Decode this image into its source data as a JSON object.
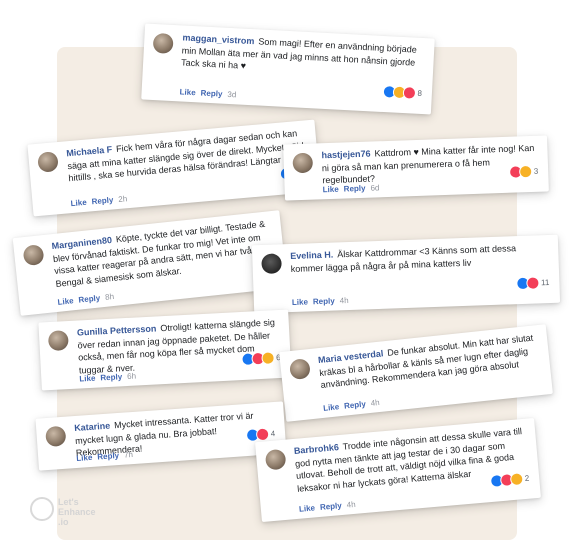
{
  "watermark": {
    "line1": "Let's",
    "line2": "Enhance",
    ".io_text": ".io"
  },
  "cards": [
    {
      "author": "maggan_vistrom",
      "text": "Som magi! Efter en användning började min Mollan äta mer än vad jag minns att hon nånsin gjorde Tack ska ni ha ♥",
      "like": "Like",
      "reply": "Reply",
      "time": "3d",
      "count": "8"
    },
    {
      "author": "Michaela F",
      "text": "Fick hem våra för några dagar sedan och kan säga att mina katter slängde sig över de direkt. Mycket nöjd hittills , ska se hurvida deras hälsa förändras! Längtar",
      "like": "Like",
      "reply": "Reply",
      "time": "2h",
      "count": "2"
    },
    {
      "author": "hastjejen76",
      "text": "Kattdrom ♥ Mina katter får inte nog! Kan ni göra så man kan prenumerera o få hem regelbundet?",
      "like": "Like",
      "reply": "Reply",
      "time": "6d",
      "count": "3"
    },
    {
      "author": "Marganinen80",
      "text": "Köpte, tyckte det var billigt. Testade & blev förvånad faktiskt. De funkar tro mig! Vet inte om vissa katter reagerar på andra sätt, men vi har två Bengal & siamesisk som älskar.",
      "like": "Like",
      "reply": "Reply",
      "time": "8h",
      "count": ""
    },
    {
      "author": "Evelina H.",
      "text": "Älskar Kattdrommar <3 Känns som att dessa kommer lägga på några år på mina katters liv",
      "like": "Like",
      "reply": "Reply",
      "time": "4h",
      "count": "11"
    },
    {
      "author": "Gunilla Pettersson",
      "text": "Otroligt! katterna slängde sig över redan innan jag öppnade paketet. De håller också, men får nog köpa fler så mycket dom tuggar & nver.",
      "like": "Like",
      "reply": "Reply",
      "time": "6h",
      "count": "6"
    },
    {
      "author": "Maria vesterdal",
      "text": "De funkar absolut. Min katt har slutat kräkas bl a hårbollar & känls så mer lugn efter daglig användning. Rekommendera kan jag göra absolut",
      "like": "Like",
      "reply": "Reply",
      "time": "4h",
      "count": "4"
    },
    {
      "author": "Katarine",
      "text": "Mycket intressanta. Katter tror vi är mycket lugn & glada nu. Bra jobbat! Rekommendera!",
      "like": "Like",
      "reply": "Reply",
      "time": "7h",
      "count": "4"
    },
    {
      "author": "Barbrohk6",
      "text": "Trodde inte någonsin att dessa skulle vara till god nytta men tänkte att jag testar de i 30 dagar som utlovat. Beholl de trott att, väldigt nöjd vilka fina & goda leksakor ni har lyckats göra! Katterna älskar",
      "like": "Like",
      "reply": "Reply",
      "time": "4h",
      "count": "2"
    }
  ]
}
